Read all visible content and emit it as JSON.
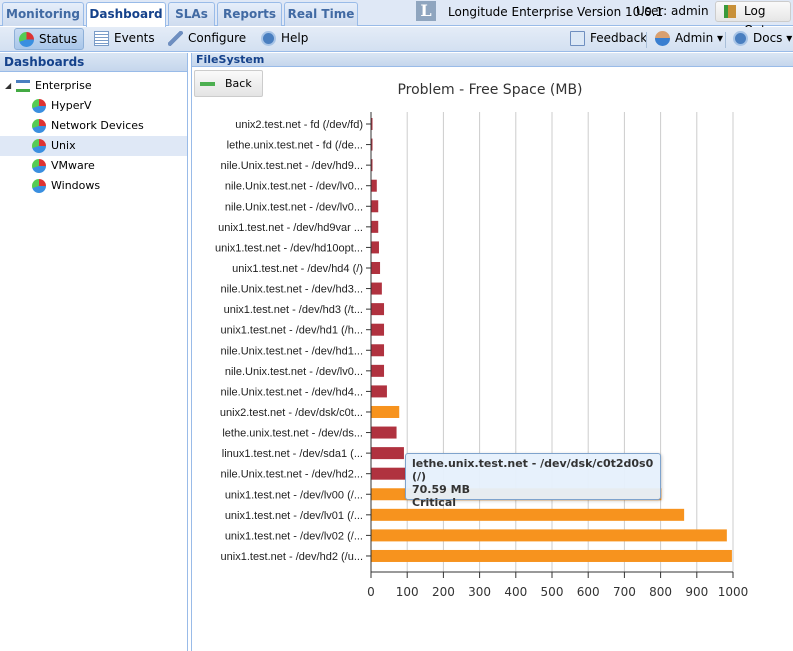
{
  "tabs": [
    {
      "label": "Monitoring"
    },
    {
      "label": "Dashboard",
      "active": true
    },
    {
      "label": "SLAs"
    },
    {
      "label": "Reports"
    },
    {
      "label": "Real Time"
    }
  ],
  "header": {
    "logo": "L",
    "product": "Longitude Enterprise Version 10.0.1",
    "user": "User: admin",
    "logout": "Log Out"
  },
  "toolbar": {
    "status": "Status",
    "events": "Events",
    "configure": "Configure",
    "help": "Help",
    "feedback": "Feedback",
    "admin": "Admin ▾",
    "docs": "Docs ▾"
  },
  "sidebar": {
    "title": "Dashboards",
    "root": "Enterprise",
    "items": [
      {
        "label": "HyperV"
      },
      {
        "label": "Network Devices"
      },
      {
        "label": "Unix",
        "selected": true
      },
      {
        "label": "VMware"
      },
      {
        "label": "Windows"
      }
    ]
  },
  "panel": {
    "title": "FileSystem",
    "back": "Back"
  },
  "tooltip": {
    "line1": "lethe.unix.test.net - /dev/dsk/c0t2d0s0 (/)",
    "line2": "70.59 MB",
    "line3": "Critical"
  },
  "colors": {
    "critical": "#b0323f",
    "warning": "#f7931e"
  },
  "chart_data": {
    "type": "bar",
    "orientation": "horizontal",
    "title": "Problem - Free Space (MB)",
    "xlabel": "",
    "ylabel": "",
    "xlim": [
      0,
      1000
    ],
    "xticks": [
      0,
      100,
      200,
      300,
      400,
      500,
      600,
      700,
      800,
      900,
      1000
    ],
    "grid": "vertical",
    "categories": [
      "unix2.test.net - fd (/dev/fd)",
      "lethe.unix.test.net - fd (/de...",
      "nile.Unix.test.net  - /dev/hd9...",
      "nile.Unix.test.net  - /dev/lv0...",
      "nile.Unix.test.net  - /dev/lv0...",
      "unix1.test.net - /dev/hd9var ...",
      "unix1.test.net - /dev/hd10opt...",
      "unix1.test.net - /dev/hd4 (/)",
      "nile.Unix.test.net  - /dev/hd3...",
      "unix1.test.net - /dev/hd3 (/t...",
      "unix1.test.net - /dev/hd1 (/h...",
      "nile.Unix.test.net  - /dev/hd1...",
      "nile.Unix.test.net  - /dev/lv0...",
      "nile.Unix.test.net  - /dev/hd4...",
      "unix2.test.net - /dev/dsk/c0t...",
      "lethe.unix.test.net - /dev/ds...",
      "linux1.test.net - /dev/sda1 (...",
      "nile.Unix.test.net  - /dev/hd2...",
      "unix1.test.net - /dev/lv00 (/...",
      "unix1.test.net - /dev/lv01 (/...",
      "unix1.test.net - /dev/lv02 (/...",
      "unix1.test.net - /dev/hd2 (/u..."
    ],
    "values": [
      1,
      1,
      1,
      16,
      20,
      20,
      22,
      25,
      30,
      36,
      36,
      36,
      36,
      44,
      78,
      70.59,
      91,
      95,
      802,
      865,
      983,
      997
    ],
    "status": [
      "critical",
      "critical",
      "critical",
      "critical",
      "critical",
      "critical",
      "critical",
      "critical",
      "critical",
      "critical",
      "critical",
      "critical",
      "critical",
      "critical",
      "warning",
      "critical",
      "critical",
      "critical",
      "warning",
      "warning",
      "warning",
      "warning"
    ]
  }
}
